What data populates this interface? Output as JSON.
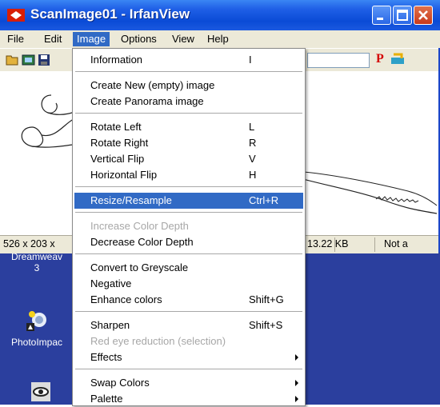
{
  "window": {
    "title": "ScanImage01 - IrfanView"
  },
  "menubar": {
    "items": [
      {
        "label": "File"
      },
      {
        "label": "Edit"
      },
      {
        "label": "Image"
      },
      {
        "label": "Options"
      },
      {
        "label": "View"
      },
      {
        "label": "Help"
      }
    ]
  },
  "toolbar": {
    "p_label": "P"
  },
  "statusbar": {
    "dimensions": "526 x 203 x",
    "size": "13.22 KB",
    "extra": "Not a"
  },
  "desktop": {
    "icons": [
      {
        "label": "Dreamweav",
        "sub": "3"
      },
      {
        "label": "PhotoImpac"
      }
    ]
  },
  "image_menu": {
    "items": [
      {
        "label": "Information",
        "shortcut": "I"
      },
      {
        "label": "Create New (empty) image",
        "shortcut": ""
      },
      {
        "label": "Create Panorama image",
        "shortcut": ""
      },
      {
        "label": "Rotate Left",
        "shortcut": "L"
      },
      {
        "label": "Rotate Right",
        "shortcut": "R"
      },
      {
        "label": "Vertical Flip",
        "shortcut": "V"
      },
      {
        "label": "Horizontal Flip",
        "shortcut": "H"
      },
      {
        "label": "Resize/Resample",
        "shortcut": "Ctrl+R",
        "selected": true
      },
      {
        "label": "Increase Color Depth",
        "shortcut": "",
        "disabled": true
      },
      {
        "label": "Decrease Color Depth",
        "shortcut": ""
      },
      {
        "label": "Convert to Greyscale",
        "shortcut": ""
      },
      {
        "label": "Negative",
        "shortcut": ""
      },
      {
        "label": "Enhance colors",
        "shortcut": "Shift+G"
      },
      {
        "label": "Sharpen",
        "shortcut": "Shift+S"
      },
      {
        "label": "Red eye reduction (selection)",
        "shortcut": "",
        "disabled": true
      },
      {
        "label": "Effects",
        "shortcut": "",
        "submenu": true
      },
      {
        "label": "Swap Colors",
        "shortcut": "",
        "submenu": true
      },
      {
        "label": "Palette",
        "shortcut": "",
        "submenu": true
      }
    ]
  },
  "colors": {
    "titlebar": "#0a4bd6",
    "desktop": "#2b3f9e",
    "selection": "#316ac5",
    "menubar": "#ece9d8"
  }
}
